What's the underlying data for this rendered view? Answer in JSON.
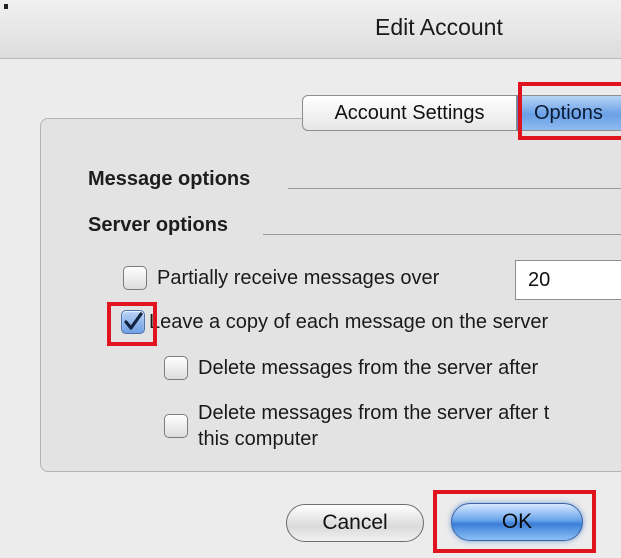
{
  "window": {
    "title": "Edit Account"
  },
  "tabs": [
    {
      "label": "Account Settings",
      "selected": false
    },
    {
      "label": "Options",
      "selected": true
    }
  ],
  "sections": {
    "message_options": "Message options",
    "server_options": "Server options"
  },
  "options": {
    "partial_receive": {
      "label": "Partially receive messages over",
      "checked": false,
      "value": "20"
    },
    "leave_copy": {
      "label": "Leave a copy of each message on the server",
      "checked": true
    },
    "delete_after": {
      "label": "Delete messages from the server after",
      "checked": false
    },
    "delete_after_computer": {
      "label_line1": "Delete messages from the server after t",
      "label_line2": "this computer",
      "checked": false
    }
  },
  "buttons": {
    "cancel": "Cancel",
    "ok": "OK"
  },
  "colors": {
    "highlight": "#e0141e",
    "accent_blue": "#6aa0e6"
  }
}
